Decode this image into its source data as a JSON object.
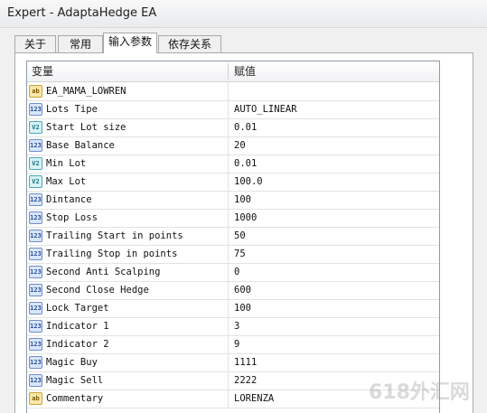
{
  "window": {
    "title": "Expert - AdaptaHedge EA"
  },
  "tabs": [
    {
      "label": "关于",
      "active": false
    },
    {
      "label": "常用",
      "active": false
    },
    {
      "label": "输入参数",
      "active": true
    },
    {
      "label": "依存关系",
      "active": false
    }
  ],
  "grid": {
    "headers": {
      "variable": "变量",
      "value": "赋值"
    },
    "rows": [
      {
        "type": "string",
        "icon": "ab",
        "name": "EA_MAMA_LOWREN",
        "value": ""
      },
      {
        "type": "int",
        "icon": "123",
        "name": "Lots Tipe",
        "value": "AUTO_LINEAR"
      },
      {
        "type": "double",
        "icon": "V2",
        "name": "Start Lot size",
        "value": "0.01"
      },
      {
        "type": "int",
        "icon": "123",
        "name": "Base Balance",
        "value": "20"
      },
      {
        "type": "double",
        "icon": "V2",
        "name": "Min Lot",
        "value": "0.01"
      },
      {
        "type": "double",
        "icon": "V2",
        "name": "Max Lot",
        "value": "100.0"
      },
      {
        "type": "int",
        "icon": "123",
        "name": "Dintance",
        "value": "100"
      },
      {
        "type": "int",
        "icon": "123",
        "name": "Stop Loss",
        "value": "1000"
      },
      {
        "type": "int",
        "icon": "123",
        "name": "Trailing Start in points",
        "value": "50"
      },
      {
        "type": "int",
        "icon": "123",
        "name": "Trailing Stop in points",
        "value": "75"
      },
      {
        "type": "int",
        "icon": "123",
        "name": "Second Anti Scalping",
        "value": "0"
      },
      {
        "type": "int",
        "icon": "123",
        "name": "Second Close Hedge",
        "value": "600"
      },
      {
        "type": "int",
        "icon": "123",
        "name": "Lock Target",
        "value": "100"
      },
      {
        "type": "int",
        "icon": "123",
        "name": "Indicator 1",
        "value": "3"
      },
      {
        "type": "int",
        "icon": "123",
        "name": "Indicator 2",
        "value": "9"
      },
      {
        "type": "int",
        "icon": "123",
        "name": "Magic Buy",
        "value": "1111"
      },
      {
        "type": "int",
        "icon": "123",
        "name": "Magic Sell",
        "value": "2222"
      },
      {
        "type": "string",
        "icon": "ab",
        "name": "Commentary",
        "value": "LORENZA"
      }
    ]
  },
  "watermark": {
    "text": "618外汇网"
  }
}
